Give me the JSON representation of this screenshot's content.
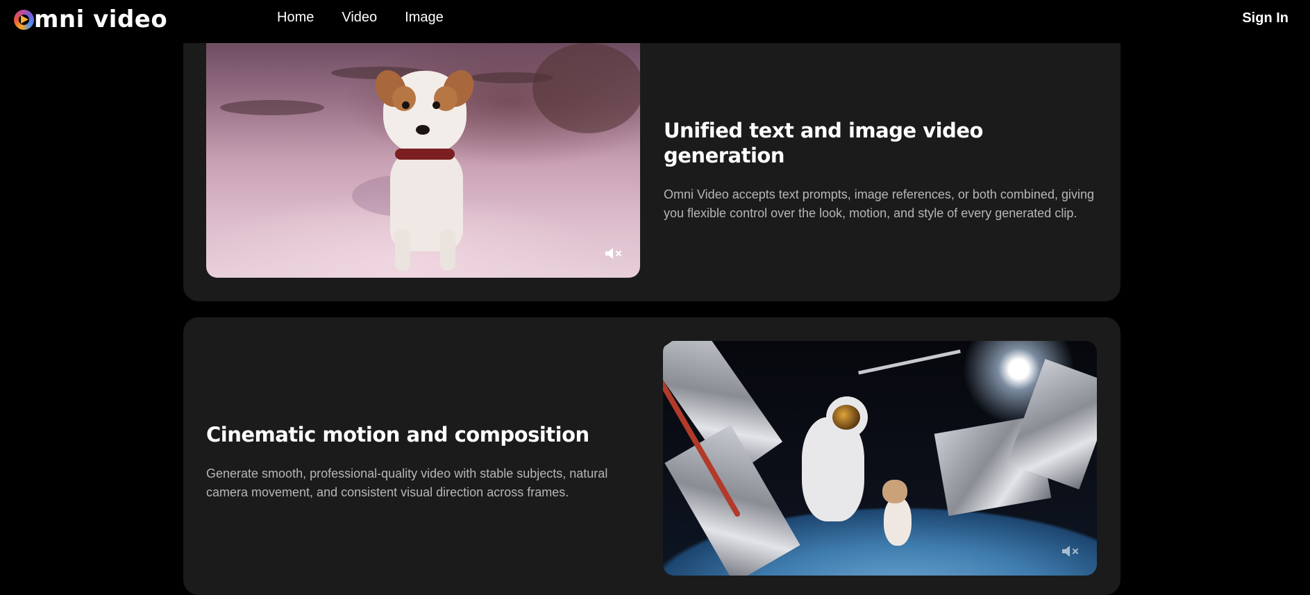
{
  "brand": {
    "name": "mni video",
    "icon": "omni-video-logo-icon"
  },
  "nav": {
    "items": [
      "Home",
      "Video",
      "Image"
    ]
  },
  "header": {
    "signin_label": "Sign In"
  },
  "features": [
    {
      "title": "Unified text and image video generation",
      "description": "Omni Video accepts text prompts, image references, or both combined, giving you flexible control over the look, motion, and style of every generated clip.",
      "video_icon": "muted-speaker-icon"
    },
    {
      "title": "Cinematic motion and composition",
      "description": "Generate smooth, professional-quality video with stable subjects, natural camera movement, and consistent visual direction across frames.",
      "video_icon": "muted-speaker-icon"
    }
  ],
  "colors": {
    "background": "#000000",
    "card": "#1b1b1c",
    "text": "#ffffff",
    "muted_text": "#b7b7b9"
  }
}
